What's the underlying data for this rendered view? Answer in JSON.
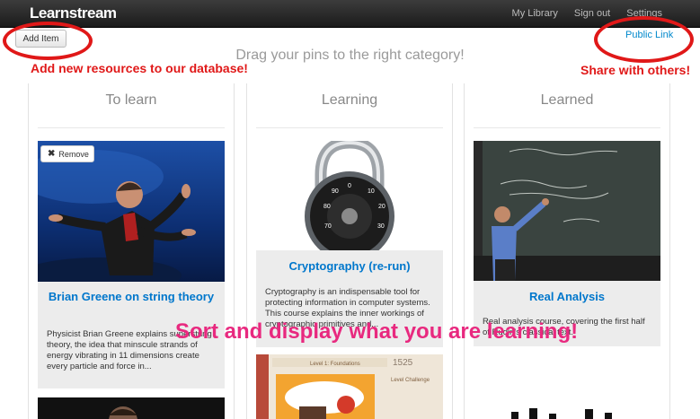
{
  "navbar": {
    "brand": "Learnstream",
    "links": [
      "My Library",
      "Sign out",
      "Settings"
    ]
  },
  "toolbar": {
    "add_item": "Add Item",
    "public_link": "Public Link",
    "drag_hint": "Drag your pins to the right category!"
  },
  "annotations": {
    "add_note": "Add new resources to our database!",
    "share_note": "Share with others!",
    "sort_note": "Sort and display what you are learning!"
  },
  "columns": [
    {
      "title": "To learn",
      "card": {
        "remove_label": "Remove",
        "title": "Brian Greene on string theory",
        "description": "Physicist Brian Greene explains superstring theory, the idea that minscule strands of energy vibrating in 11 dimensions create every particle and force in..."
      }
    },
    {
      "title": "Learning",
      "card": {
        "title": "Cryptography (re-run)",
        "description": "Cryptography is an indispensable tool for protecting information in computer systems. This course explains the inner workings of cryptographic primitives and..."
      },
      "thumb": {
        "title": "Level 1: Foundations",
        "score": "1525",
        "subtitle": "Level Challenge"
      }
    },
    {
      "title": "Learned",
      "card": {
        "title": "Real Analysis",
        "description": "Real analysis course, covering the first half of Rudin's classical text."
      }
    }
  ],
  "colors": {
    "accent_red": "#e01818",
    "accent_pink": "#e8297f",
    "link_blue": "#0077cc"
  }
}
